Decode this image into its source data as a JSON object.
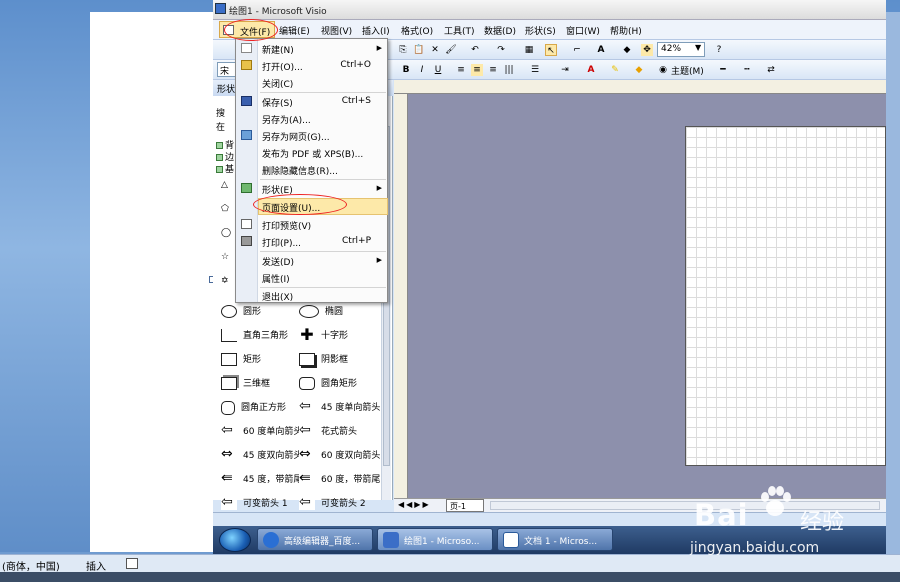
{
  "visio": {
    "title": "绘图1 - Microsoft Visio",
    "zoom": "42%",
    "font": "宋",
    "menu": [
      "文件(F)",
      "编辑(E)",
      "视图(V)",
      "插入(I)",
      "格式(O)",
      "工具(T)",
      "数据(D)",
      "形状(S)",
      "窗口(W)",
      "帮助(H)"
    ],
    "format_theme": "主题(M)",
    "shapes_header": "形状",
    "search_label": "搜",
    "search_label2": "在",
    "stencils": [
      "背",
      "边",
      "基"
    ],
    "shapes": [
      [
        "圆形",
        "椭圆"
      ],
      [
        "直角三角形",
        "十字形"
      ],
      [
        "矩形",
        "阴影框"
      ],
      [
        "三维框",
        "圆角矩形"
      ],
      [
        "圆角正方形",
        "45 度单向箭头"
      ],
      [
        "60 度单向箭头",
        "花式箭头"
      ],
      [
        "45 度双向箭头",
        "60 度双向箭头"
      ],
      [
        "45 度，带箭尾",
        "60 度，带箭尾"
      ],
      [
        "可变箭头 1",
        "可变箭头 2"
      ]
    ],
    "page_tab": "页-1"
  },
  "file_menu": {
    "items": [
      {
        "label": "新建(N)",
        "shortcut": "",
        "sub": true
      },
      {
        "label": "打开(O)...",
        "shortcut": "Ctrl+O"
      },
      {
        "label": "关闭(C)",
        "shortcut": ""
      },
      {
        "label": "保存(S)",
        "shortcut": "Ctrl+S"
      },
      {
        "label": "另存为(A)...",
        "shortcut": ""
      },
      {
        "label": "另存为网页(G)...",
        "shortcut": ""
      },
      {
        "label": "发布为 PDF 或 XPS(B)...",
        "shortcut": ""
      },
      {
        "label": "删除隐藏信息(R)...",
        "shortcut": ""
      },
      {
        "label": "形状(E)",
        "shortcut": "",
        "sub": true
      },
      {
        "label": "页面设置(U)...",
        "shortcut": "",
        "highlight": true
      },
      {
        "label": "打印预览(V)",
        "shortcut": ""
      },
      {
        "label": "打印(P)...",
        "shortcut": "Ctrl+P"
      },
      {
        "label": "发送(D)",
        "shortcut": "",
        "sub": true
      },
      {
        "label": "属性(I)",
        "shortcut": ""
      },
      {
        "label": "退出(X)",
        "shortcut": ""
      }
    ]
  },
  "taskbar": {
    "items": [
      "高级编辑器_百度...",
      "绘图1 - Microso...",
      "文档 1 - Micros..."
    ]
  },
  "word_status": {
    "ime": "(商体，中国)",
    "mode": "插入"
  },
  "watermark": {
    "brand": "Bai",
    "brand2": "经验",
    "url": "jingyan.baidu.com"
  },
  "colors": {
    "highlight": "#fde9a9",
    "annotation": "#e22222",
    "taskbar": "#2a4a7a"
  }
}
